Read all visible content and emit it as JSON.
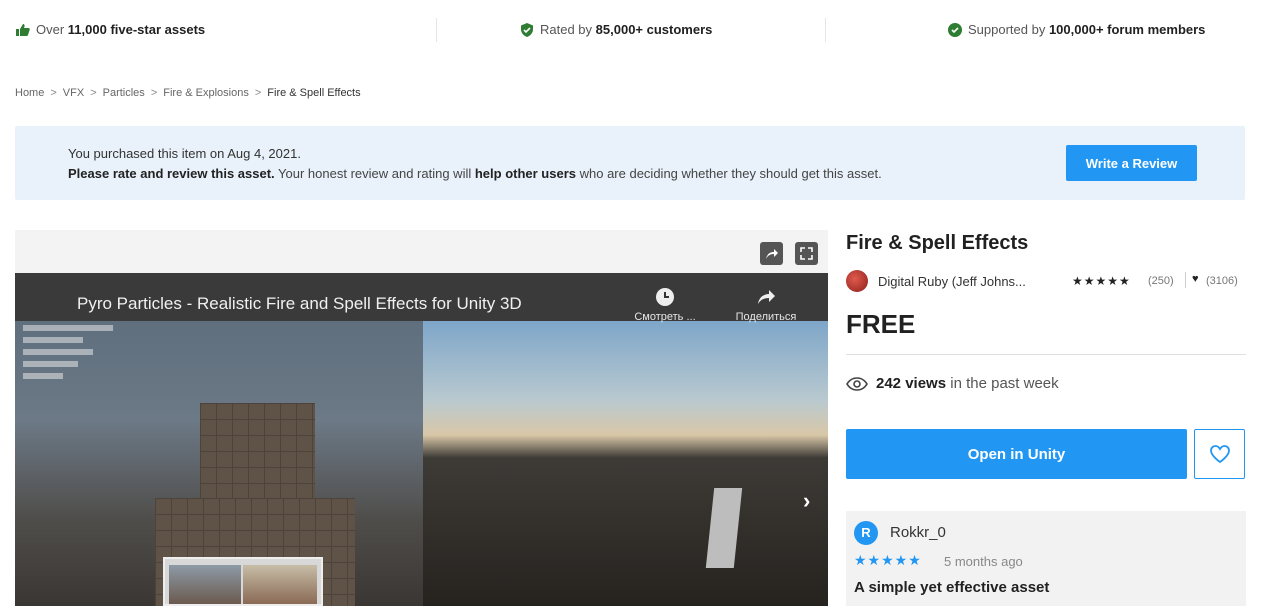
{
  "trust_bar": {
    "item1_prefix": "Over ",
    "item1_bold": "11,000 five-star assets",
    "item2_prefix": "Rated by ",
    "item2_bold": "85,000+ customers",
    "item3_prefix": "Supported by ",
    "item3_bold": "100,000+ forum members"
  },
  "breadcrumb": {
    "items": [
      "Home",
      "VFX",
      "Particles",
      "Fire & Explosions"
    ],
    "current": "Fire & Spell Effects",
    "separator": ">"
  },
  "banner": {
    "line1": "You purchased this item on Aug 4, 2021.",
    "line2_bold1": "Please rate and review this asset.",
    "line2_text1": " Your honest review and rating will ",
    "line2_bold2": "help other users",
    "line2_text2": " who are deciding whether they should get this asset.",
    "button_label": "Write a Review"
  },
  "video": {
    "title": "Pyro Particles - Realistic Fire and Spell Effects for Unity 3D",
    "watch_label": "Смотреть ...",
    "share_label": "Поделиться",
    "next_glyph": "›"
  },
  "product": {
    "title": "Fire & Spell Effects",
    "publisher": "Digital Ruby (Jeff Johns...",
    "rating_stars": "★★★★★",
    "rating_count": "(250)",
    "favorites_count": "(3106)",
    "price": "FREE",
    "views_count": "242 views",
    "views_suffix": "in the past week",
    "open_button": "Open in Unity"
  },
  "review": {
    "avatar_letter": "R",
    "user": "Rokkr_0",
    "stars": "★★★★★",
    "time": "5 months ago",
    "title": "A simple yet effective asset"
  },
  "colors": {
    "accent": "#2196f3",
    "banner_bg": "#e9f1fa",
    "trust_icon": "#2e7d32"
  }
}
